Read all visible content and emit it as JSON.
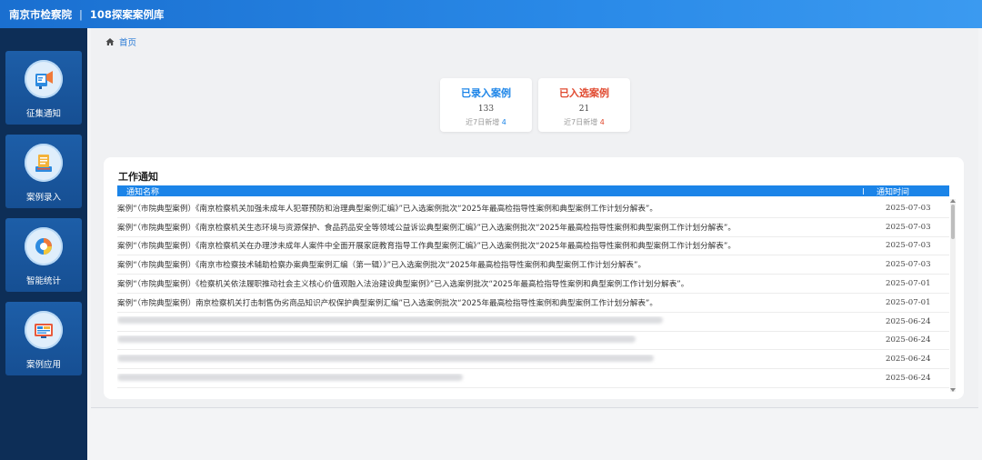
{
  "header": {
    "org": "南京市检察院",
    "separator": "|",
    "app": "108探案案例库"
  },
  "sidebar": {
    "items": [
      {
        "label": "征集通知",
        "icon": "megaphone-icon"
      },
      {
        "label": "案例录入",
        "icon": "document-entry-icon"
      },
      {
        "label": "智能统计",
        "icon": "pie-chart-icon"
      },
      {
        "label": "案例应用",
        "icon": "monitor-app-icon"
      }
    ]
  },
  "breadcrumb": {
    "home": "首页"
  },
  "stats": [
    {
      "title": "已录入案例",
      "value": "133",
      "recent_label": "近7日新增",
      "recent_value": "4",
      "color": "#1b84e8"
    },
    {
      "title": "已入选案例",
      "value": "21",
      "recent_label": "近7日新增",
      "recent_value": "4",
      "color": "#e0492f"
    }
  ],
  "notices": {
    "title": "工作通知",
    "columns": [
      "通知名称",
      "通知时间"
    ],
    "rows": [
      {
        "name": "案例“（市院典型案例）《南京检察机关加强未成年人犯罪预防和治理典型案例汇编》”已入选案例批次“2025年最高检指导性案例和典型案例工作计划分解表”。",
        "date": "2025-07-03"
      },
      {
        "name": "案例“（市院典型案例）《南京检察机关生态环境与资源保护、食品药品安全等领域公益诉讼典型案例汇编》”已入选案例批次“2025年最高检指导性案例和典型案例工作计划分解表”。",
        "date": "2025-07-03"
      },
      {
        "name": "案例“（市院典型案例）《南京检察机关在办理涉未成年人案件中全面开展家庭教育指导工作典型案例汇编》”已入选案例批次“2025年最高检指导性案例和典型案例工作计划分解表”。",
        "date": "2025-07-03"
      },
      {
        "name": "案例“（市院典型案例）《南京市检察技术辅助检察办案典型案例汇编（第一辑）》”已入选案例批次“2025年最高检指导性案例和典型案例工作计划分解表”。",
        "date": "2025-07-03"
      },
      {
        "name": "案例“（市院典型案例）《检察机关依法履职推动社会主义核心价值观融入法治建设典型案例》”已入选案例批次“2025年最高检指导性案例和典型案例工作计划分解表”。",
        "date": "2025-07-01"
      },
      {
        "name": "案例“（市院典型案例）南京检察机关打击制售伪劣商品知识产权保护典型案例汇编”已入选案例批次“2025年最高检指导性案例和典型案例工作计划分解表”。",
        "date": "2025-07-01"
      },
      {
        "name": "",
        "date": "2025-06-24"
      },
      {
        "name": "",
        "date": "2025-06-24"
      },
      {
        "name": "",
        "date": "2025-06-24"
      },
      {
        "name": "",
        "date": "2025-06-24"
      }
    ]
  }
}
